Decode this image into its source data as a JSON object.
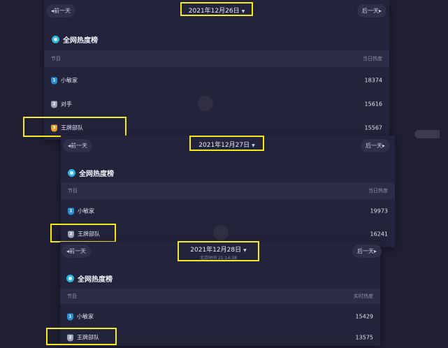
{
  "nav": {
    "prev": "◂前一天",
    "next": "后一天▸"
  },
  "panels": [
    {
      "date": "2021年12月26日",
      "title": "全网热度榜",
      "col_left": "节目",
      "col_right": "当日热度",
      "rows": [
        {
          "rank": "1",
          "name": "小敏家",
          "value": "18374"
        },
        {
          "rank": "2",
          "name": "对手",
          "value": "15616"
        },
        {
          "rank": "3",
          "name": "王牌部队",
          "value": "15567"
        }
      ]
    },
    {
      "date": "2021年12月27日",
      "title": "全网热度榜",
      "col_left": "节目",
      "col_right": "当日热度",
      "rows": [
        {
          "rank": "1",
          "name": "小敏家",
          "value": "19973"
        },
        {
          "rank": "2",
          "name": "王牌部队",
          "value": "16241"
        }
      ]
    },
    {
      "date": "2021年12月28日",
      "subtitle": "北京时间 21:14:38",
      "title": "全网热度榜",
      "col_left": "节目",
      "col_right": "实时热度",
      "rows": [
        {
          "rank": "1",
          "name": "小敏家",
          "value": "15429"
        },
        {
          "rank": "2",
          "name": "王牌部队",
          "value": "13575"
        }
      ]
    }
  ],
  "colors": {
    "highlight": "#f5ea1a",
    "accent": "#2bb5e0"
  }
}
